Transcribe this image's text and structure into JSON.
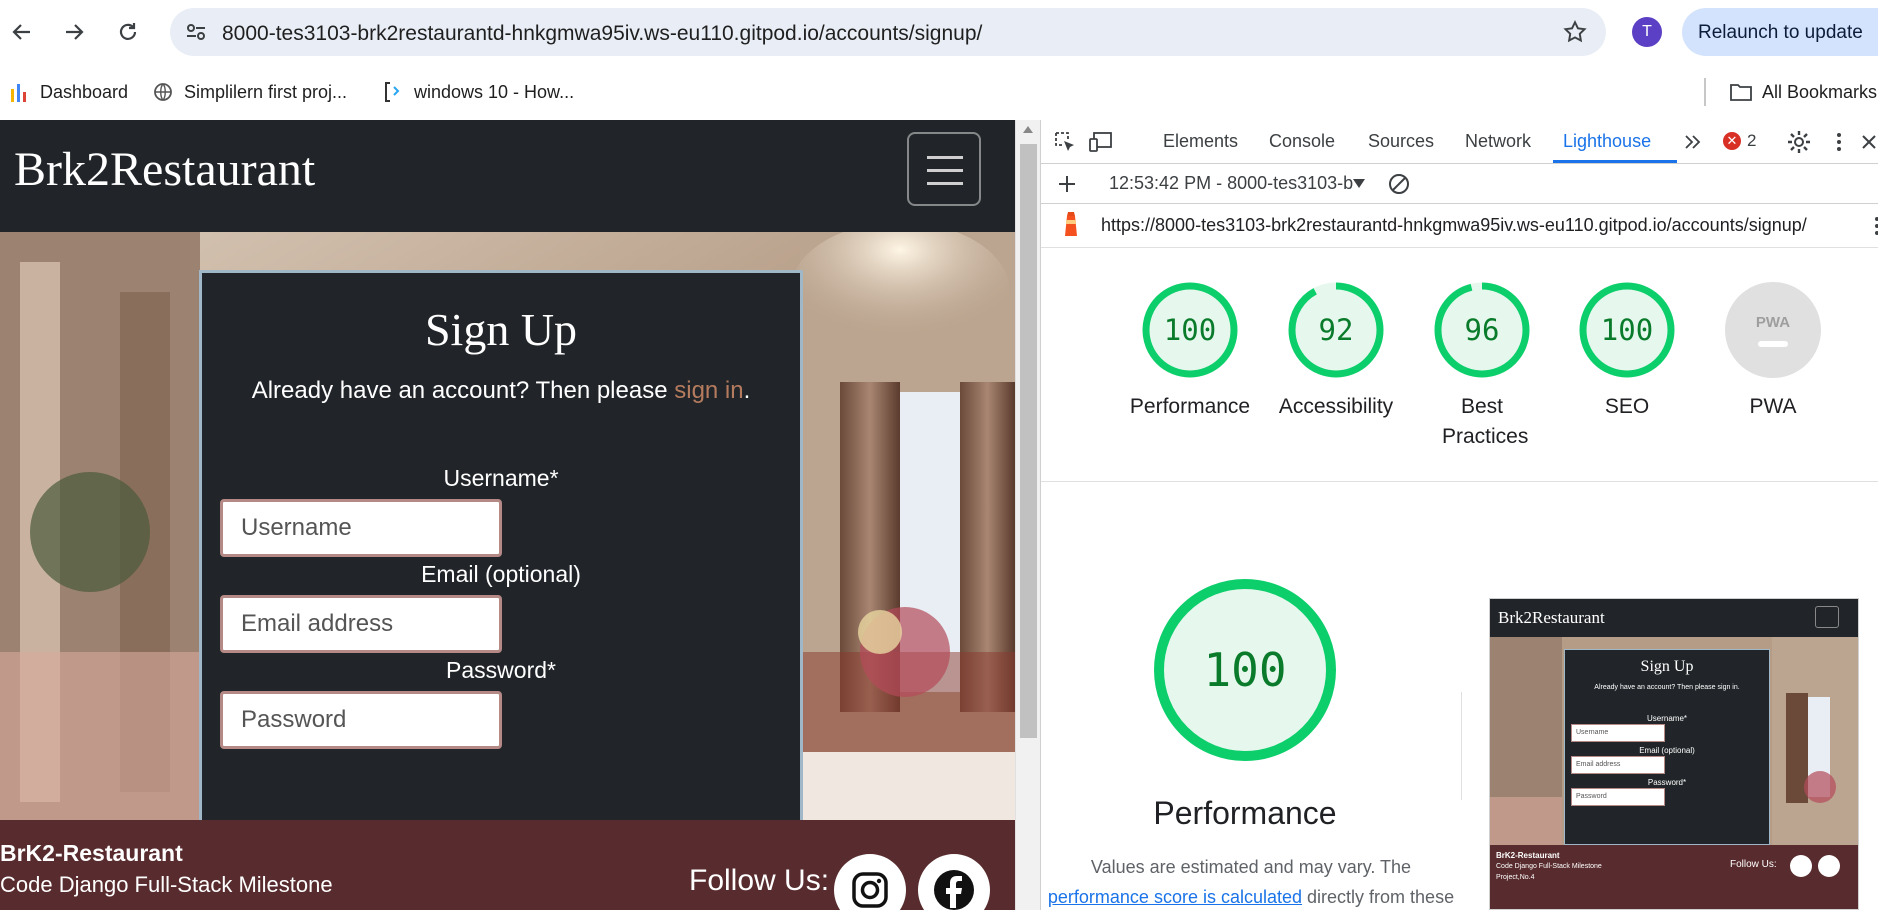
{
  "browser": {
    "url": "8000-tes3103-brk2restaurantd-hnkgmwa95iv.ws-eu110.gitpod.io/accounts/signup/",
    "profile_initial": "T",
    "relaunch_label": "Relaunch to update",
    "bookmarks": [
      "Dashboard",
      "Simplilern first proj...",
      "windows 10 - How..."
    ],
    "all_bookmarks": "All Bookmarks"
  },
  "site": {
    "brand": "Brk2Restaurant",
    "signup": {
      "title": "Sign Up",
      "prompt": "Already have an account? Then please",
      "sign_in_link": "sign in",
      "prompt_end": ".",
      "username_label": "Username*",
      "username_placeholder": "Username",
      "email_label": "Email (optional)",
      "email_placeholder": "Email address",
      "password_label": "Password*",
      "password_placeholder": "Password"
    },
    "footer": {
      "title": "BrK2-Restaurant",
      "subtitle": "Code Django Full-Stack Milestone",
      "follow": "Follow Us:"
    }
  },
  "devtools": {
    "tabs": [
      "Elements",
      "Console",
      "Sources",
      "Network",
      "Lighthouse"
    ],
    "active_tab": "Lighthouse",
    "error_count": "2",
    "report_time": "12:53:42 PM - 8000-tes3103-b",
    "report_url": "https://8000-tes3103-brk2restaurantd-hnkgmwa95iv.ws-eu110.gitpod.io/accounts/signup/",
    "scores": [
      {
        "label": "Performance",
        "value": 100
      },
      {
        "label": "Accessibility",
        "value": 92
      },
      {
        "label": "Best Practices",
        "value": 96
      },
      {
        "label": "SEO",
        "value": 100
      },
      {
        "label": "PWA",
        "value": null
      }
    ],
    "pwa_text": "PWA",
    "big_score": "100",
    "big_label": "Performance",
    "note_text": "Values are estimated and may vary. The",
    "note_link": "performance score is calculated",
    "note_tail": "directly from these",
    "thumbnail": {
      "brand": "Brk2Restaurant",
      "title": "Sign Up",
      "prompt": "Already have an account? Then please sign in.",
      "username_label": "Username*",
      "username": "Username",
      "email_label": "Email (optional)",
      "email": "Email address",
      "password_label": "Password*",
      "password": "Password",
      "footer_title": "BrK2-Restaurant",
      "footer_sub": "Code Django Full-Stack Milestone",
      "footer_sub2": "Project,No.4",
      "follow": "Follow Us:"
    }
  },
  "colors": {
    "score_good": "#0cce6b",
    "score_text": "#0a7a2b",
    "nav_dark": "#212529",
    "footer": "#582c2e",
    "link": "#b57b5e"
  }
}
